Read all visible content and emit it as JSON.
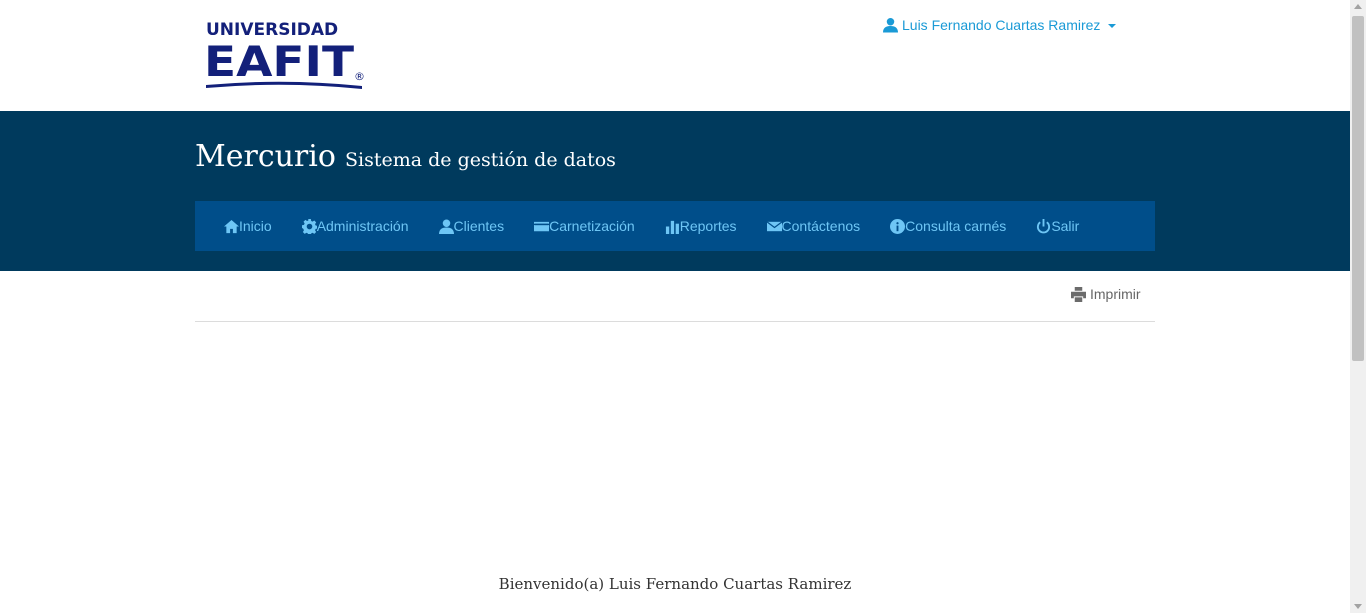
{
  "logo": {
    "line1": "UNIVERSIDAD",
    "line2": "EAFIT",
    "mark": "®",
    "color": "#13207a"
  },
  "user": {
    "name": "Luis Fernando Cuartas Ramirez",
    "icon": "user-icon"
  },
  "header": {
    "title": "Mercurio",
    "subtitle": "Sistema de gestión de datos"
  },
  "nav": {
    "items": [
      {
        "label": "Inicio",
        "icon": "home-icon"
      },
      {
        "label": "Administración",
        "icon": "gear-icon"
      },
      {
        "label": "Clientes",
        "icon": "user-icon"
      },
      {
        "label": "Carnetización",
        "icon": "card-icon"
      },
      {
        "label": "Reportes",
        "icon": "bar-chart-icon"
      },
      {
        "label": "Contáctenos",
        "icon": "envelope-icon"
      },
      {
        "label": "Consulta carnés",
        "icon": "info-icon"
      },
      {
        "label": "Salir",
        "icon": "power-icon"
      }
    ]
  },
  "toolbar": {
    "print_label": "Imprimir",
    "print_icon": "printer-icon"
  },
  "main": {
    "welcome": "Bienvenido(a) Luis Fernando Cuartas Ramirez"
  },
  "colors": {
    "band": "#003a5d",
    "nav": "#004e8a",
    "nav_text": "#6ec6f5",
    "link": "#1a9ad6"
  }
}
